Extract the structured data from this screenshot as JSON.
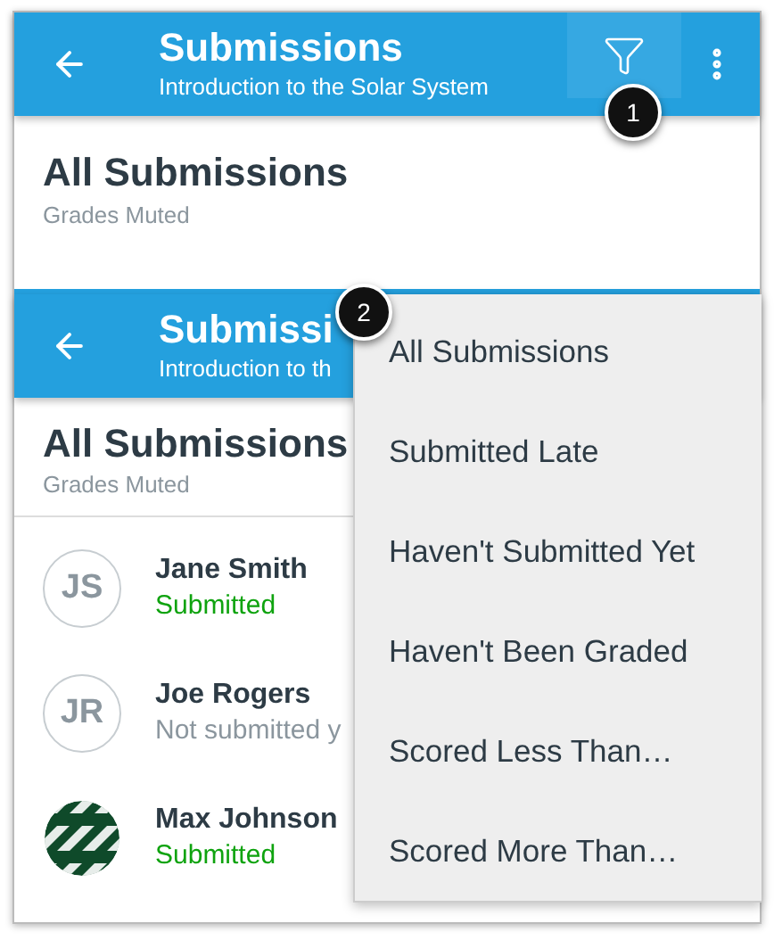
{
  "top_screen": {
    "app_bar": {
      "title": "Submissions",
      "subtitle": "Introduction to the Solar System"
    },
    "heading": "All Submissions",
    "subheading": "Grades Muted",
    "callout": "1"
  },
  "bottom_screen": {
    "app_bar": {
      "title": "Submissi",
      "subtitle": "Introduction to th"
    },
    "heading": "All Submissions",
    "subheading": "Grades Muted",
    "students": [
      {
        "kind": "initials",
        "initials": "JS",
        "name": "Jane Smith",
        "status": "Submitted",
        "submitted": true
      },
      {
        "kind": "initials",
        "initials": "JR",
        "name": "Joe Rogers",
        "status": "Not submitted y",
        "submitted": false
      },
      {
        "kind": "picture",
        "name": "Max Johnson",
        "status": "Submitted",
        "submitted": true
      }
    ],
    "filter_menu": [
      "All Submissions",
      "Submitted Late",
      "Haven't Submitted Yet",
      "Haven't Been Graded",
      "Scored Less Than…",
      "Scored More Than…"
    ],
    "callout": "2"
  }
}
